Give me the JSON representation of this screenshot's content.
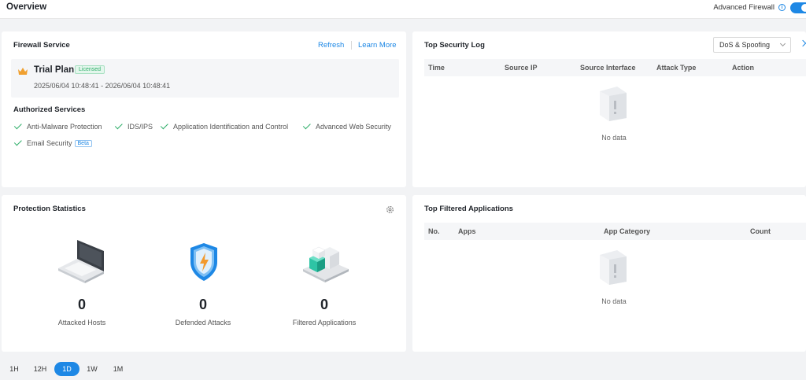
{
  "header": {
    "title": "Overview",
    "advanced_firewall_label": "Advanced Firewall",
    "advanced_firewall_enabled": true
  },
  "firewall_service": {
    "title": "Firewall Service",
    "refresh": "Refresh",
    "learn_more": "Learn More",
    "plan_name": "Trial Plan",
    "plan_badge": "Licensed",
    "plan_dates": "2025/06/04 10:48:41 - 2026/06/04 10:48:41",
    "authorized_title": "Authorized Services",
    "services": [
      "Anti-Malware Protection",
      "IDS/IPS",
      "Application Identification and Control",
      "Advanced Web Security",
      "Email Security"
    ],
    "beta_badge": "Beta"
  },
  "protection_stats": {
    "title": "Protection Statistics",
    "items": [
      {
        "value": "0",
        "label": "Attacked Hosts",
        "icon": "laptop-icon"
      },
      {
        "value": "0",
        "label": "Defended Attacks",
        "icon": "shield-icon"
      },
      {
        "value": "0",
        "label": "Filtered Applications",
        "icon": "cubes-icon"
      }
    ]
  },
  "security_log": {
    "title": "Top Security Log",
    "filter_value": "DoS & Spoofing",
    "columns": [
      "Time",
      "Source IP",
      "Source Interface",
      "Attack Type",
      "Action"
    ],
    "empty_text": "No data"
  },
  "filtered_apps": {
    "title": "Top Filtered Applications",
    "columns": [
      "No.",
      "Apps",
      "App Category",
      "Count"
    ],
    "empty_text": "No data"
  },
  "time_ranges": {
    "options": [
      "1H",
      "12H",
      "1D",
      "1W",
      "1M"
    ],
    "selected": "1D"
  },
  "colors": {
    "accent": "#1e88e5",
    "success": "#2fae6a",
    "crown": "#f0a030"
  }
}
